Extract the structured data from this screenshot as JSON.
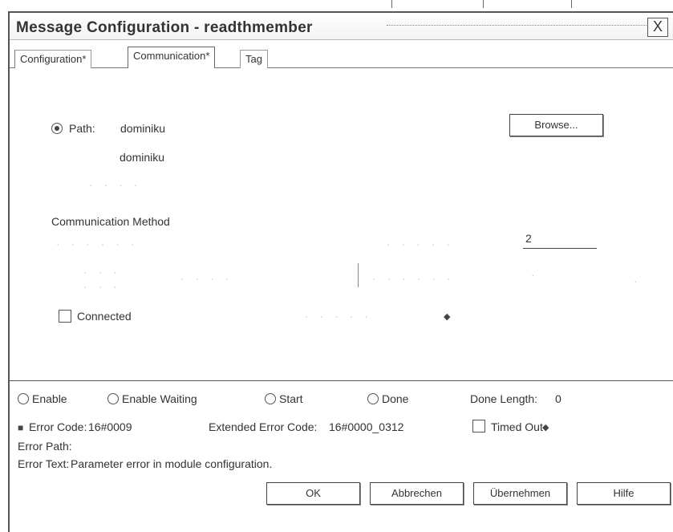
{
  "window": {
    "title": "Message Configuration - readthmember",
    "close_glyph": "X"
  },
  "tabs": [
    {
      "label": "Configuration*"
    },
    {
      "label": "Communication*"
    },
    {
      "label": "Tag"
    }
  ],
  "communication": {
    "path_label": "Path:",
    "path_value": "dominiku",
    "path_resolved": "dominiku",
    "browse_label": "Browse...",
    "method_label": "Communication Method",
    "channel_value": "2",
    "connected_label": "Connected",
    "connected_checked": false
  },
  "status": {
    "enable_label": "Enable",
    "enable_waiting_label": "Enable Waiting",
    "start_label": "Start",
    "done_label": "Done",
    "done_length_label": "Done Length:",
    "done_length_value": "0",
    "error_code_label": "Error Code:",
    "error_code_value": "16#0009",
    "extended_error_label": "Extended Error Code:",
    "extended_error_value": "16#0000_0312",
    "timed_out_label": "Timed Out",
    "timed_out_checked": false,
    "error_path_label": "Error Path:",
    "error_text_label": "Error Text:",
    "error_text_value": "Parameter error in module configuration."
  },
  "buttons": {
    "ok": "OK",
    "cancel": "Abbrechen",
    "apply": "Übernehmen",
    "help": "Hilfe"
  }
}
